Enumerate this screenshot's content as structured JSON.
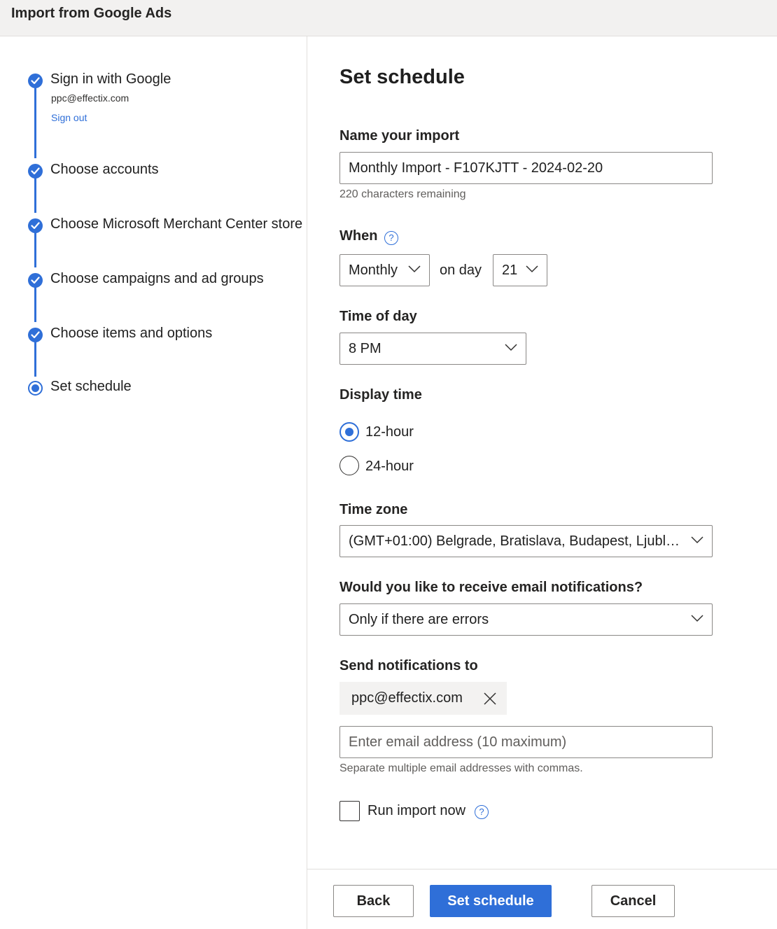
{
  "window": {
    "title": "Import from Google Ads"
  },
  "colors": {
    "accent": "#2f6fd8",
    "topbar": "#f2f1f0"
  },
  "steps": [
    {
      "label": "Sign in with Google",
      "status": "complete",
      "icon": "checkmark-icon"
    },
    {
      "label": "Choose accounts",
      "status": "complete",
      "icon": "checkmark-icon"
    },
    {
      "label": "Choose Microsoft Merchant Center store",
      "status": "complete",
      "icon": "checkmark-icon"
    },
    {
      "label": "Choose campaigns and ad groups",
      "status": "complete",
      "icon": "checkmark-icon"
    },
    {
      "label": "Choose items and options",
      "status": "complete",
      "icon": "checkmark-icon"
    },
    {
      "label": "Set schedule",
      "status": "current",
      "icon": "current-step-icon"
    }
  ],
  "account": {
    "email": "ppc@effectix.com",
    "sign_out": "Sign out"
  },
  "main": {
    "title": "Set schedule",
    "name": {
      "label": "Name your import",
      "value": "Monthly Import - F107KJTT - 2024-02-20",
      "helper": "220 characters remaining"
    },
    "when": {
      "label": "When",
      "frequency": "Monthly",
      "on_day_label": "on day",
      "day": "21"
    },
    "time_of_day": {
      "label": "Time of day",
      "value": "8 PM"
    },
    "display_time": {
      "label": "Display time",
      "options": [
        {
          "label": "12-hour",
          "selected": true
        },
        {
          "label": "24-hour",
          "selected": false
        }
      ]
    },
    "time_zone": {
      "label": "Time zone",
      "value": "(GMT+01:00) Belgrade, Bratislava, Budapest, Ljubljan..."
    },
    "notifications": {
      "label": "Would you like to receive email notifications?",
      "value": "Only if there are errors"
    },
    "send_to": {
      "label": "Send notifications to",
      "chip": "ppc@effectix.com",
      "placeholder": "Enter email address (10 maximum)",
      "helper": "Separate multiple email addresses with commas."
    },
    "run_now": {
      "label": "Run import now",
      "checked": false
    }
  },
  "footer": {
    "back": "Back",
    "submit": "Set schedule",
    "cancel": "Cancel"
  }
}
